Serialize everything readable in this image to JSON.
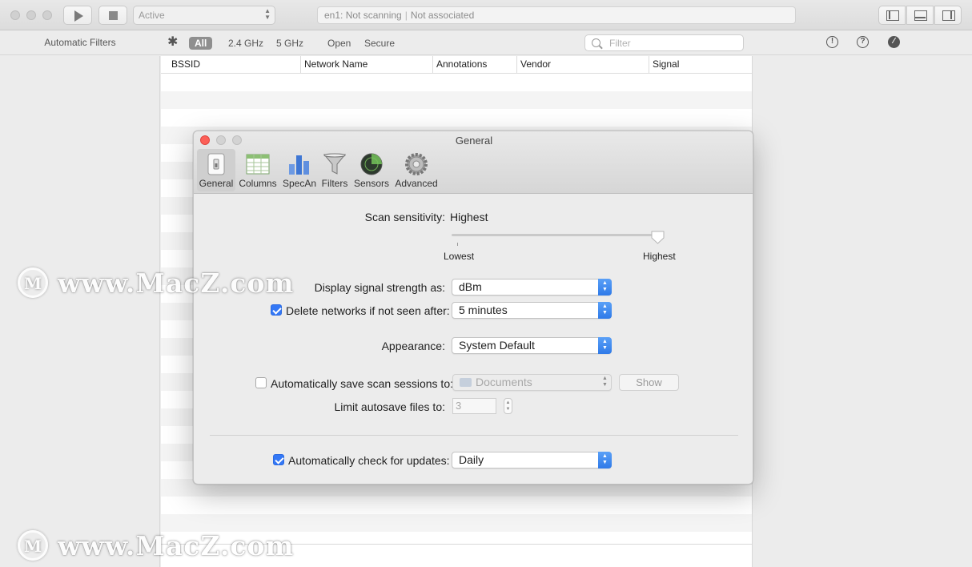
{
  "toolbar": {
    "state_popup": "Active",
    "status_interface": "en1: Not scanning",
    "status_association": "Not associated"
  },
  "filterbar": {
    "automatic_filters": "Automatic Filters",
    "chips": [
      "All",
      "2.4 GHz",
      "5 GHz",
      "Open",
      "Secure"
    ],
    "search_placeholder": "Filter"
  },
  "table": {
    "columns": [
      "BSSID",
      "Network Name",
      "Annotations",
      "Vendor",
      "Signal"
    ]
  },
  "prefs": {
    "title": "General",
    "tabs": [
      "General",
      "Columns",
      "SpecAn",
      "Filters",
      "Sensors",
      "Advanced"
    ],
    "selected_tab": "General",
    "scan_sensitivity_label": "Scan sensitivity:",
    "scan_sensitivity_value": "Highest",
    "slider_min_label": "Lowest",
    "slider_max_label": "Highest",
    "slider_level": 1.0,
    "signal_strength_label": "Display signal strength as:",
    "signal_strength_value": "dBm",
    "delete_networks_label": "Delete networks if not seen after:",
    "delete_networks_checked": true,
    "delete_networks_value": "5 minutes",
    "appearance_label": "Appearance:",
    "appearance_value": "System Default",
    "autosave_label": "Automatically save scan sessions to:",
    "autosave_checked": false,
    "autosave_folder": "Documents",
    "show_button": "Show",
    "limit_autosave_label": "Limit autosave files to:",
    "limit_autosave_value": "3",
    "updates_label": "Automatically check for updates:",
    "updates_checked": true,
    "updates_value": "Daily"
  },
  "watermark": {
    "text": "www.MacZ.com",
    "logo_letter": "M"
  },
  "colors": {
    "accent": "#3478f6",
    "close_red": "#fc5f57"
  }
}
